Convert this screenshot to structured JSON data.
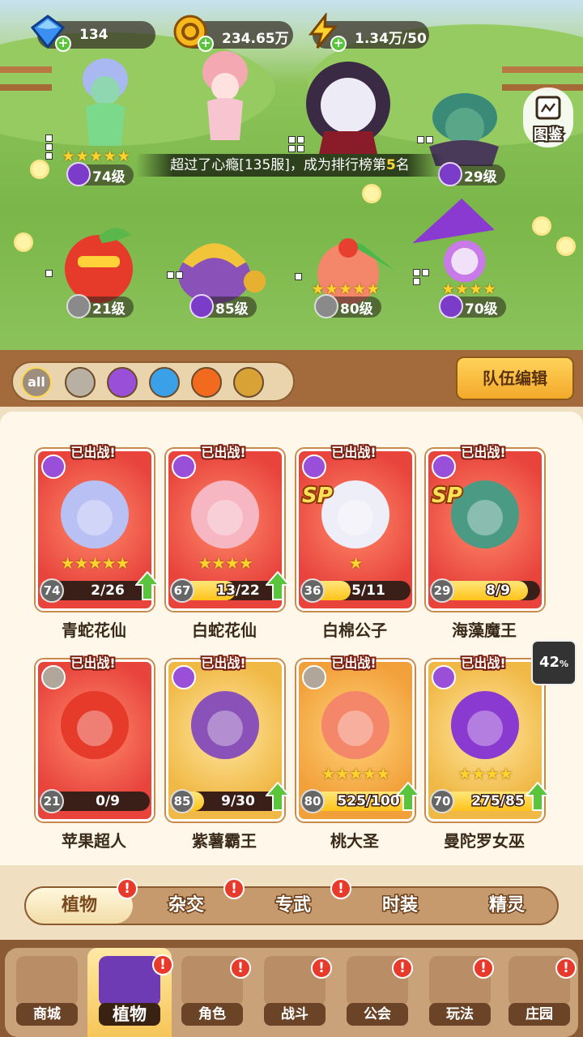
{
  "resources": [
    {
      "name": "gem-icon",
      "value": "134"
    },
    {
      "name": "gold-icon",
      "value": "234.65万"
    },
    {
      "name": "energy-icon",
      "value": "1.34万/50"
    }
  ],
  "atlas_label": "图鉴",
  "toast": {
    "prefix": "超过了心瘾[135服]，成为排行榜第",
    "rank": "5",
    "suffix": "名"
  },
  "team_heroes": [
    {
      "level": "74级",
      "stars": "★★★★★",
      "element": "potion"
    },
    {
      "level": "",
      "stars": "",
      "element": "potion"
    },
    {
      "level": "",
      "stars": "",
      "element": "potion"
    },
    {
      "level": "29级",
      "stars": "",
      "element": "potion"
    },
    {
      "level": "21级",
      "stars": "",
      "element": "sword"
    },
    {
      "level": "85级",
      "stars": "",
      "element": "potion"
    },
    {
      "level": "80级",
      "stars": "★★★★★",
      "element": "sword"
    },
    {
      "level": "70级",
      "stars": "★★★★",
      "element": "potion"
    }
  ],
  "filters": [
    {
      "label": "all"
    },
    {
      "label": "sword"
    },
    {
      "label": "potion"
    },
    {
      "label": "water"
    },
    {
      "label": "fire"
    },
    {
      "label": "lightning"
    }
  ],
  "team_edit_label": "队伍编辑",
  "deployed_tag": "已出战!",
  "sp_label": "SP",
  "cards": [
    {
      "name": "青蛇花仙",
      "level": "74",
      "progress": "2/26",
      "fill": 0.08,
      "stars": "★★★★★",
      "upgrade": true,
      "sp": false,
      "element": "potion"
    },
    {
      "name": "白蛇花仙",
      "level": "67",
      "progress": "13/22",
      "fill": 0.59,
      "stars": "★★★★",
      "upgrade": true,
      "sp": false,
      "element": "potion"
    },
    {
      "name": "白棉公子",
      "level": "36",
      "progress": "5/11",
      "fill": 0.45,
      "stars": "★",
      "upgrade": false,
      "sp": true,
      "element": "potion"
    },
    {
      "name": "海藻魔王",
      "level": "29",
      "progress": "8/9",
      "fill": 0.89,
      "stars": "",
      "upgrade": false,
      "sp": true,
      "element": "potion"
    },
    {
      "name": "苹果超人",
      "level": "21",
      "progress": "0/9",
      "fill": 0.0,
      "stars": "",
      "upgrade": false,
      "sp": false,
      "element": "sword"
    },
    {
      "name": "紫薯霸王",
      "level": "85",
      "progress": "9/30",
      "fill": 0.3,
      "stars": "",
      "upgrade": true,
      "sp": false,
      "element": "potion"
    },
    {
      "name": "桃大圣",
      "level": "80",
      "progress": "525/100",
      "fill": 1.0,
      "stars": "★★★★★",
      "upgrade": true,
      "sp": false,
      "element": "sword"
    },
    {
      "name": "曼陀罗女巫",
      "level": "70",
      "progress": "275/85",
      "fill": 1.0,
      "stars": "★★★★",
      "upgrade": true,
      "sp": false,
      "element": "potion"
    }
  ],
  "download_percent": "42",
  "download_unit": "%",
  "subtabs": [
    {
      "label": "植物",
      "alert": true,
      "active": true
    },
    {
      "label": "杂交",
      "alert": true,
      "active": false
    },
    {
      "label": "专武",
      "alert": true,
      "active": false
    },
    {
      "label": "时装",
      "alert": false,
      "active": false
    },
    {
      "label": "精灵",
      "alert": false,
      "active": false
    }
  ],
  "nav": [
    {
      "label": "商城",
      "alert": false,
      "active": false
    },
    {
      "label": "植物",
      "alert": true,
      "active": true
    },
    {
      "label": "角色",
      "alert": true,
      "active": false
    },
    {
      "label": "战斗",
      "alert": true,
      "active": false
    },
    {
      "label": "公会",
      "alert": true,
      "active": false
    },
    {
      "label": "玩法",
      "alert": true,
      "active": false
    },
    {
      "label": "庄园",
      "alert": true,
      "active": false
    }
  ],
  "alert_mark": "!",
  "colors": {
    "deployed_red": "#e8443c",
    "gold_card": "#f0b845",
    "accent_yellow": "#ffd22e",
    "progress_fill": "#ffc21a",
    "upgrade_green": "#5ac43c"
  }
}
